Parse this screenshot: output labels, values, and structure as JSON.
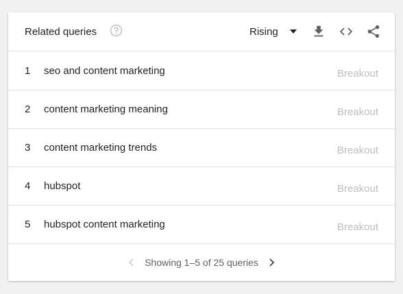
{
  "header": {
    "title": "Related queries",
    "selector_value": "Rising",
    "icons": [
      "help-icon",
      "caret-down-icon",
      "download-icon",
      "embed-code-icon",
      "share-icon"
    ]
  },
  "rows": [
    {
      "rank": "1",
      "query": "seo and content marketing",
      "value": "Breakout"
    },
    {
      "rank": "2",
      "query": "content marketing meaning",
      "value": "Breakout"
    },
    {
      "rank": "3",
      "query": "content marketing trends",
      "value": "Breakout"
    },
    {
      "rank": "4",
      "query": "hubspot",
      "value": "Breakout"
    },
    {
      "rank": "5",
      "query": "hubspot content marketing",
      "value": "Breakout"
    }
  ],
  "footer": {
    "pagination_text": "Showing 1–5 of 25 queries"
  },
  "colors": {
    "page_background": "#f1f1f1",
    "card_background": "#ffffff",
    "divider": "#e0e0e0",
    "text_primary": "#212121",
    "text_muted": "#bdbdbd",
    "icon": "#616161"
  }
}
